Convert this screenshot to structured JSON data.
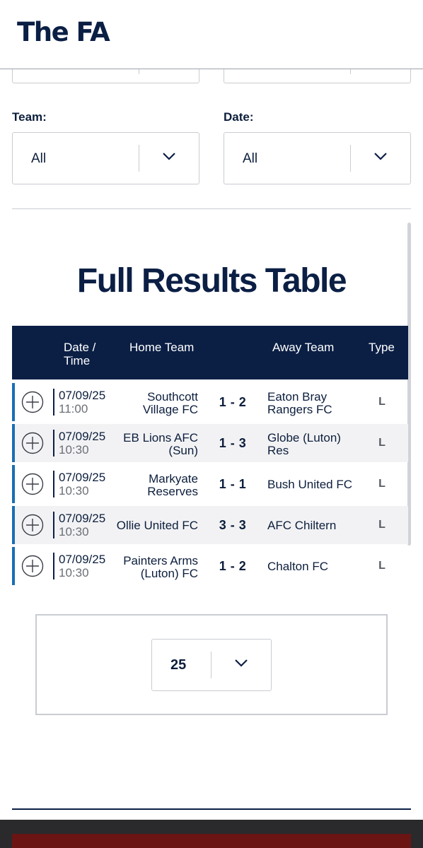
{
  "header": {
    "logo_text": "The FA"
  },
  "filters": {
    "top_left_value": "",
    "top_right_value": "",
    "team": {
      "label": "Team:",
      "value": "All"
    },
    "date": {
      "label": "Date:",
      "value": "All"
    }
  },
  "results": {
    "title": "Full Results Table",
    "columns": {
      "date_time_line1": "Date /",
      "date_time_line2": "Time",
      "home_team": "Home Team",
      "away_team": "Away Team",
      "type": "Type"
    },
    "rows": [
      {
        "date": "07/09/25",
        "time": "11:00",
        "home_l1": "Southcott",
        "home_l2": "Village FC",
        "score": "1 - 2",
        "away_l1": "Eaton Bray",
        "away_l2": "Rangers FC",
        "type": "L"
      },
      {
        "date": "07/09/25",
        "time": "10:30",
        "home_l1": "EB Lions AFC",
        "home_l2": "(Sun)",
        "score": "1 - 3",
        "away_l1": "Globe (Luton)",
        "away_l2": "Res",
        "type": "L"
      },
      {
        "date": "07/09/25",
        "time": "10:30",
        "home_l1": "Markyate",
        "home_l2": "Reserves",
        "score": "1 - 1",
        "away_l1": "Bush United FC",
        "away_l2": "",
        "type": "L"
      },
      {
        "date": "07/09/25",
        "time": "10:30",
        "home_l1": "Ollie United FC",
        "home_l2": "",
        "score": "3 - 3",
        "away_l1": "AFC Chiltern",
        "away_l2": "",
        "type": "L"
      },
      {
        "date": "07/09/25",
        "time": "10:30",
        "home_l1": "Painters Arms",
        "home_l2": "(Luton) FC",
        "score": "1 - 2",
        "away_l1": "Chalton FC",
        "away_l2": "",
        "type": "L"
      }
    ]
  },
  "pagination": {
    "page_size": "25"
  },
  "icons": {
    "expand": "plus-circle-icon",
    "dropdown": "chevron-down-icon"
  },
  "colors": {
    "navy": "#0b1f45",
    "accent_blue": "#1b6eb3"
  }
}
